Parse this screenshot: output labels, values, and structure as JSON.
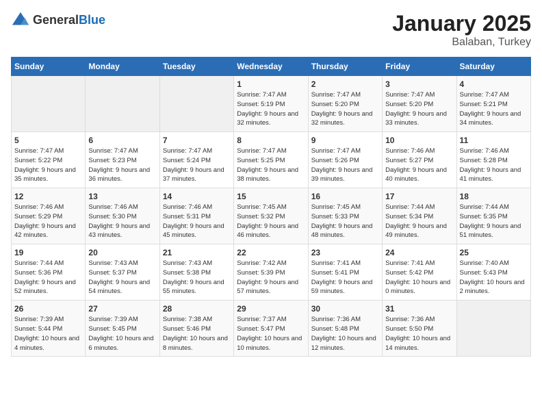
{
  "logo": {
    "general": "General",
    "blue": "Blue"
  },
  "title": "January 2025",
  "location": "Balaban, Turkey",
  "weekdays": [
    "Sunday",
    "Monday",
    "Tuesday",
    "Wednesday",
    "Thursday",
    "Friday",
    "Saturday"
  ],
  "weeks": [
    [
      {
        "day": "",
        "info": ""
      },
      {
        "day": "",
        "info": ""
      },
      {
        "day": "",
        "info": ""
      },
      {
        "day": "1",
        "info": "Sunrise: 7:47 AM\nSunset: 5:19 PM\nDaylight: 9 hours and 32 minutes."
      },
      {
        "day": "2",
        "info": "Sunrise: 7:47 AM\nSunset: 5:20 PM\nDaylight: 9 hours and 32 minutes."
      },
      {
        "day": "3",
        "info": "Sunrise: 7:47 AM\nSunset: 5:20 PM\nDaylight: 9 hours and 33 minutes."
      },
      {
        "day": "4",
        "info": "Sunrise: 7:47 AM\nSunset: 5:21 PM\nDaylight: 9 hours and 34 minutes."
      }
    ],
    [
      {
        "day": "5",
        "info": "Sunrise: 7:47 AM\nSunset: 5:22 PM\nDaylight: 9 hours and 35 minutes."
      },
      {
        "day": "6",
        "info": "Sunrise: 7:47 AM\nSunset: 5:23 PM\nDaylight: 9 hours and 36 minutes."
      },
      {
        "day": "7",
        "info": "Sunrise: 7:47 AM\nSunset: 5:24 PM\nDaylight: 9 hours and 37 minutes."
      },
      {
        "day": "8",
        "info": "Sunrise: 7:47 AM\nSunset: 5:25 PM\nDaylight: 9 hours and 38 minutes."
      },
      {
        "day": "9",
        "info": "Sunrise: 7:47 AM\nSunset: 5:26 PM\nDaylight: 9 hours and 39 minutes."
      },
      {
        "day": "10",
        "info": "Sunrise: 7:46 AM\nSunset: 5:27 PM\nDaylight: 9 hours and 40 minutes."
      },
      {
        "day": "11",
        "info": "Sunrise: 7:46 AM\nSunset: 5:28 PM\nDaylight: 9 hours and 41 minutes."
      }
    ],
    [
      {
        "day": "12",
        "info": "Sunrise: 7:46 AM\nSunset: 5:29 PM\nDaylight: 9 hours and 42 minutes."
      },
      {
        "day": "13",
        "info": "Sunrise: 7:46 AM\nSunset: 5:30 PM\nDaylight: 9 hours and 43 minutes."
      },
      {
        "day": "14",
        "info": "Sunrise: 7:46 AM\nSunset: 5:31 PM\nDaylight: 9 hours and 45 minutes."
      },
      {
        "day": "15",
        "info": "Sunrise: 7:45 AM\nSunset: 5:32 PM\nDaylight: 9 hours and 46 minutes."
      },
      {
        "day": "16",
        "info": "Sunrise: 7:45 AM\nSunset: 5:33 PM\nDaylight: 9 hours and 48 minutes."
      },
      {
        "day": "17",
        "info": "Sunrise: 7:44 AM\nSunset: 5:34 PM\nDaylight: 9 hours and 49 minutes."
      },
      {
        "day": "18",
        "info": "Sunrise: 7:44 AM\nSunset: 5:35 PM\nDaylight: 9 hours and 51 minutes."
      }
    ],
    [
      {
        "day": "19",
        "info": "Sunrise: 7:44 AM\nSunset: 5:36 PM\nDaylight: 9 hours and 52 minutes."
      },
      {
        "day": "20",
        "info": "Sunrise: 7:43 AM\nSunset: 5:37 PM\nDaylight: 9 hours and 54 minutes."
      },
      {
        "day": "21",
        "info": "Sunrise: 7:43 AM\nSunset: 5:38 PM\nDaylight: 9 hours and 55 minutes."
      },
      {
        "day": "22",
        "info": "Sunrise: 7:42 AM\nSunset: 5:39 PM\nDaylight: 9 hours and 57 minutes."
      },
      {
        "day": "23",
        "info": "Sunrise: 7:41 AM\nSunset: 5:41 PM\nDaylight: 9 hours and 59 minutes."
      },
      {
        "day": "24",
        "info": "Sunrise: 7:41 AM\nSunset: 5:42 PM\nDaylight: 10 hours and 0 minutes."
      },
      {
        "day": "25",
        "info": "Sunrise: 7:40 AM\nSunset: 5:43 PM\nDaylight: 10 hours and 2 minutes."
      }
    ],
    [
      {
        "day": "26",
        "info": "Sunrise: 7:39 AM\nSunset: 5:44 PM\nDaylight: 10 hours and 4 minutes."
      },
      {
        "day": "27",
        "info": "Sunrise: 7:39 AM\nSunset: 5:45 PM\nDaylight: 10 hours and 6 minutes."
      },
      {
        "day": "28",
        "info": "Sunrise: 7:38 AM\nSunset: 5:46 PM\nDaylight: 10 hours and 8 minutes."
      },
      {
        "day": "29",
        "info": "Sunrise: 7:37 AM\nSunset: 5:47 PM\nDaylight: 10 hours and 10 minutes."
      },
      {
        "day": "30",
        "info": "Sunrise: 7:36 AM\nSunset: 5:48 PM\nDaylight: 10 hours and 12 minutes."
      },
      {
        "day": "31",
        "info": "Sunrise: 7:36 AM\nSunset: 5:50 PM\nDaylight: 10 hours and 14 minutes."
      },
      {
        "day": "",
        "info": ""
      }
    ]
  ]
}
